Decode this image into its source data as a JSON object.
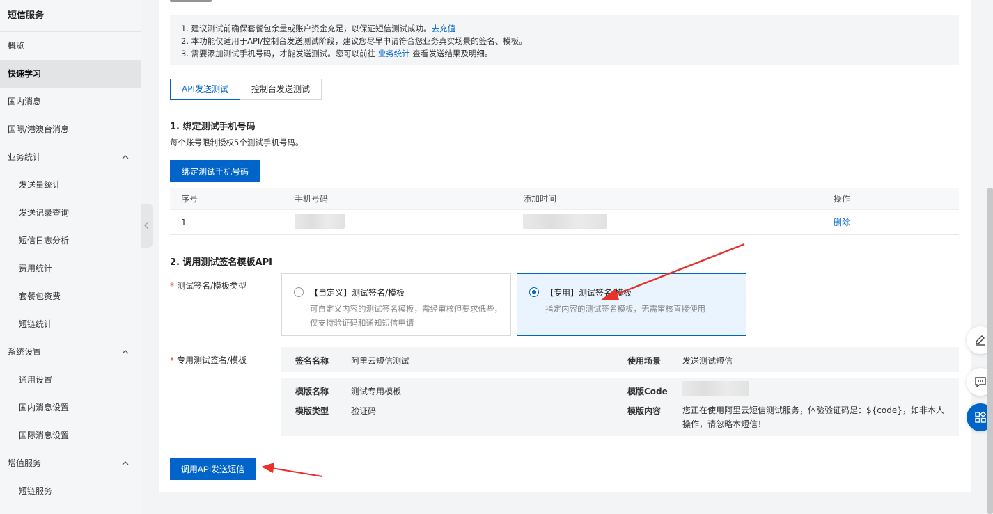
{
  "sidebar": {
    "title": "短信服务",
    "items": [
      {
        "label": "概览"
      },
      {
        "label": "快速学习"
      },
      {
        "label": "国内消息"
      },
      {
        "label": "国际/港澳台消息"
      },
      {
        "label": "业务统计"
      },
      {
        "label": "发送量统计"
      },
      {
        "label": "发送记录查询"
      },
      {
        "label": "短信日志分析"
      },
      {
        "label": "费用统计"
      },
      {
        "label": "套餐包资费"
      },
      {
        "label": "短链统计"
      },
      {
        "label": "系统设置"
      },
      {
        "label": "通用设置"
      },
      {
        "label": "国内消息设置"
      },
      {
        "label": "国际消息设置"
      },
      {
        "label": "增值服务"
      },
      {
        "label": "短链服务"
      }
    ]
  },
  "notice": {
    "line1": "1. 建议测试前确保套餐包余量或账户资金充足，以保证短信测试成功。",
    "line1_link": "去充值",
    "line2": "2. 本功能仅适用于API/控制台发送测试阶段，建议您尽早申请符合您业务真实场景的签名、模板。",
    "line3_pre": "3. 需要添加测试手机号码，才能发送测试。您可以前往 ",
    "line3_link": "业务统计",
    "line3_post": " 查看发送结果及明细。"
  },
  "tabs": [
    {
      "label": "API发送测试"
    },
    {
      "label": "控制台发送测试"
    }
  ],
  "section1": {
    "title": "1. 绑定测试手机号码",
    "desc": "每个账号限制授权5个测试手机号码。",
    "button": "绑定测试手机号码"
  },
  "table": {
    "headers": [
      "序号",
      "手机号码",
      "添加时间",
      "操作"
    ],
    "rows": [
      {
        "index": "1",
        "action": "删除"
      }
    ]
  },
  "section2": {
    "title": "2. 调用测试签名模板API",
    "type_label": "测试签名/模板类型",
    "options": [
      {
        "title": "【自定义】测试签名/模板",
        "desc": "可自定义内容的测试签名模板，需经审核但要求低些，仅支持验证码和通知短信申请"
      },
      {
        "title": "【专用】测试签名/模板",
        "desc": "指定内容的测试签名模板，无需审核直接使用"
      }
    ],
    "template_label": "专用测试签名/模板",
    "info": {
      "sign_name_label": "签名名称",
      "sign_name": "阿里云短信测试",
      "scene_label": "使用场景",
      "scene": "发送测试短信",
      "tpl_name_label": "模版名称",
      "tpl_name": "测试专用模板",
      "tpl_code_label": "模版Code",
      "tpl_type_label": "模版类型",
      "tpl_type": "验证码",
      "tpl_content_label": "模版内容",
      "tpl_content": "您正在使用阿里云短信测试服务，体验验证码是：${code}，如非本人操作，请忽略本短信！"
    },
    "submit": "调用API发送短信"
  },
  "colors": {
    "primary": "#0064c8",
    "arrow": "#e8322b"
  }
}
